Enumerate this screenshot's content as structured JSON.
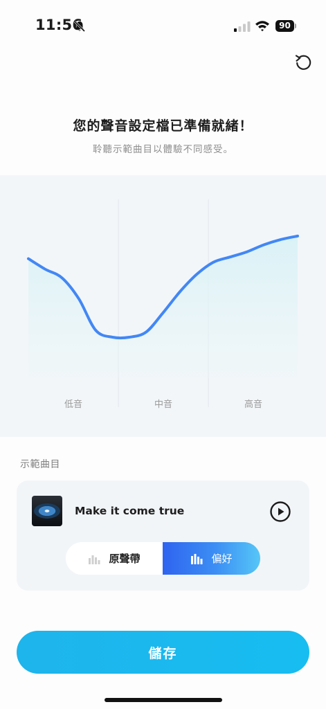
{
  "status_bar": {
    "time": "11:56",
    "battery": "90",
    "icons": [
      "bell-slash-icon",
      "cellular-signal-icon",
      "wifi-icon",
      "battery-icon"
    ]
  },
  "header": {
    "reset_icon": "reset-icon",
    "title": "您的聲音設定檔已準備就緒！",
    "subtitle": "聆聽示範曲目以體驗不同感受。"
  },
  "equalizer": {
    "bands": [
      "低音",
      "中音",
      "高音"
    ],
    "curve_color": "#4287f5",
    "fill_color": "#dff4f7",
    "curve_levels": [
      0.68,
      0.62,
      0.57,
      0.45,
      0.27,
      0.23,
      0.23,
      0.26,
      0.37,
      0.49,
      0.59,
      0.66,
      0.69,
      0.72,
      0.76,
      0.79,
      0.81
    ]
  },
  "demo": {
    "section_label": "示範曲目",
    "track_title": "Make it come true",
    "play_icon": "play-circle-icon",
    "options": {
      "original": "原聲帶",
      "preferred": "偏好"
    },
    "selected": "preferred"
  },
  "save_label": "儲存",
  "colors": {
    "accent": "#1eb4ec",
    "toggle_active_start": "#2f64f0",
    "toggle_active_end": "#56c6f7"
  }
}
